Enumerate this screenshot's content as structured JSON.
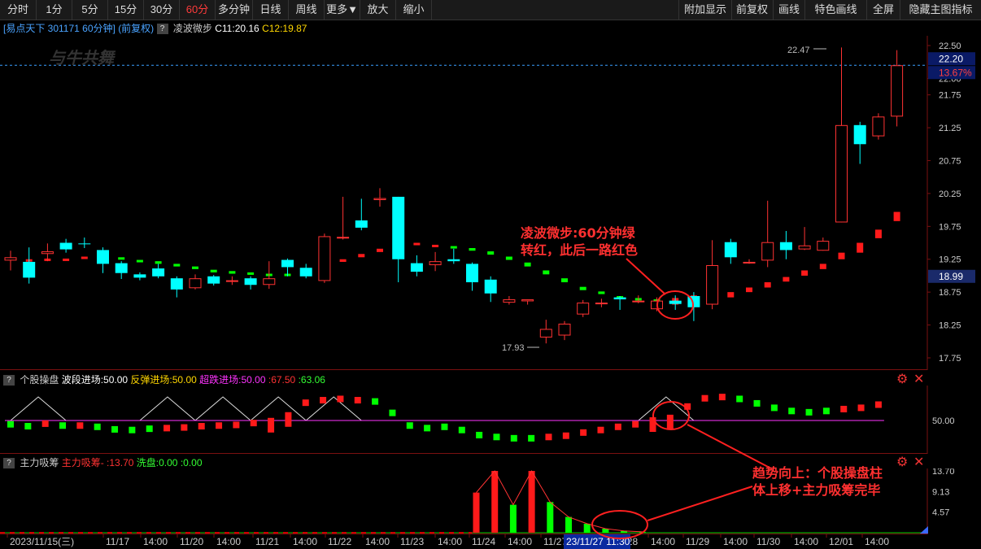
{
  "toolbar": {
    "left": [
      "分时",
      "1分",
      "5分",
      "15分",
      "30分",
      "60分",
      "多分钟",
      "日线",
      "周线",
      "更多▼",
      "放大",
      "缩小"
    ],
    "active": "60分",
    "right": [
      "附加显示",
      "前复权",
      "画线",
      "特色画线",
      "全屏",
      "隐藏主图指标"
    ]
  },
  "header": {
    "stock": "[易点天下 301171 60分钟]",
    "adjust": "(前复权)",
    "q": "?",
    "indicator_name": "凌波微步",
    "c1": "C11:20.16",
    "c2": "C12:19.87"
  },
  "watermark": "与牛共舞",
  "main": {
    "y_ticks": [
      "22.50",
      "22.00",
      "21.75",
      "21.25",
      "20.75",
      "20.25",
      "19.75",
      "19.25",
      "18.75",
      "18.25",
      "17.75"
    ],
    "price_badge": "22.20",
    "pct_badge": "13.67%",
    "cursor_badge": "18.99",
    "high_label": "22.47",
    "low_label": "17.93",
    "colors": {
      "up": "#ff3232",
      "down": "#00ffff",
      "bg": "#000000"
    },
    "candles": [
      [
        19.23,
        19.28,
        19.38,
        19.08
      ],
      [
        19.21,
        18.97,
        19.43,
        18.88
      ],
      [
        19.33,
        19.37,
        19.49,
        19.22
      ],
      [
        19.5,
        19.4,
        19.56,
        19.35
      ],
      [
        19.49,
        19.48,
        19.58,
        19.42
      ],
      [
        19.39,
        19.18,
        19.43,
        19.04
      ],
      [
        19.19,
        19.04,
        19.22,
        18.95
      ],
      [
        19.02,
        18.97,
        19.05,
        18.93
      ],
      [
        19.11,
        18.99,
        19.18,
        18.96
      ],
      [
        18.96,
        18.79,
        18.99,
        18.67
      ],
      [
        18.81,
        18.96,
        19.02,
        18.79
      ],
      [
        18.99,
        18.88,
        19.01,
        18.85
      ],
      [
        18.91,
        18.93,
        18.99,
        18.86
      ],
      [
        18.96,
        18.86,
        18.99,
        18.79
      ],
      [
        18.86,
        18.96,
        19.22,
        18.8
      ],
      [
        19.24,
        19.13,
        19.26,
        18.99
      ],
      [
        19.12,
        18.99,
        19.18,
        18.96
      ],
      [
        18.92,
        19.6,
        19.64,
        18.89
      ],
      [
        19.59,
        19.59,
        20.2,
        19.55
      ],
      [
        19.84,
        19.73,
        20.17,
        19.69
      ],
      [
        20.15,
        20.18,
        20.33,
        20.05
      ],
      [
        20.2,
        19.25,
        20.2,
        18.9
      ],
      [
        19.19,
        19.06,
        19.31,
        18.99
      ],
      [
        19.16,
        19.22,
        19.36,
        19.07
      ],
      [
        19.25,
        19.22,
        19.41,
        19.18
      ],
      [
        19.18,
        18.9,
        19.2,
        18.77
      ],
      [
        18.94,
        18.73,
        18.99,
        18.6
      ],
      [
        18.59,
        18.64,
        18.69,
        18.56
      ],
      [
        18.61,
        18.64,
        18.64,
        18.56
      ],
      [
        18.06,
        18.19,
        18.33,
        17.97
      ],
      [
        18.09,
        18.27,
        18.31,
        18.02
      ],
      [
        18.41,
        18.59,
        18.63,
        18.37
      ],
      [
        18.59,
        18.59,
        18.65,
        18.52
      ],
      [
        18.67,
        18.64,
        18.69,
        18.48
      ],
      [
        18.62,
        18.62,
        18.7,
        18.58
      ],
      [
        18.49,
        18.62,
        18.67,
        18.46
      ],
      [
        18.62,
        18.57,
        18.7,
        18.48
      ],
      [
        18.69,
        18.52,
        18.75,
        18.31
      ],
      [
        18.56,
        19.16,
        19.54,
        18.49
      ],
      [
        19.51,
        19.28,
        19.56,
        19.18
      ],
      [
        19.19,
        19.21,
        19.25,
        19.18
      ],
      [
        19.23,
        19.51,
        20.14,
        19.13
      ],
      [
        19.51,
        19.39,
        19.68,
        19.25
      ],
      [
        19.4,
        19.46,
        19.74,
        19.39
      ],
      [
        19.38,
        19.53,
        19.58,
        19.38
      ],
      [
        19.81,
        21.29,
        22.47,
        19.81
      ],
      [
        21.29,
        21.0,
        21.34,
        20.7
      ],
      [
        21.12,
        21.42,
        21.47,
        21.07
      ],
      [
        21.42,
        22.2,
        22.43,
        21.27
      ]
    ],
    "kai_bars": [
      [
        0,
        19.24,
        19.27,
        "r"
      ],
      [
        1,
        19.22,
        19.25,
        "r"
      ],
      [
        2,
        19.23,
        19.26,
        "r"
      ],
      [
        3,
        19.23,
        19.26,
        "r"
      ],
      [
        4,
        19.26,
        19.29,
        "r"
      ],
      [
        5,
        19.24,
        19.27,
        "r"
      ],
      [
        6,
        19.25,
        19.28,
        "g"
      ],
      [
        7,
        19.21,
        19.24,
        "g"
      ],
      [
        8,
        19.18,
        19.22,
        "g"
      ],
      [
        9,
        19.14,
        19.18,
        "g"
      ],
      [
        10,
        19.1,
        19.14,
        "g"
      ],
      [
        11,
        19.05,
        19.09,
        "g"
      ],
      [
        12,
        19.03,
        19.07,
        "g"
      ],
      [
        13,
        19.02,
        19.05,
        "g"
      ],
      [
        14,
        19.01,
        19.03,
        "g"
      ],
      [
        15,
        19.0,
        19.03,
        "g"
      ],
      [
        16,
        19.01,
        19.03,
        "g"
      ],
      [
        17,
        19.13,
        19.17,
        "r"
      ],
      [
        18,
        19.21,
        19.25,
        "r"
      ],
      [
        19,
        19.28,
        19.33,
        "r"
      ],
      [
        20,
        19.36,
        19.41,
        "r"
      ],
      [
        21,
        19.43,
        19.47,
        "r"
      ],
      [
        22,
        19.47,
        19.5,
        "r"
      ],
      [
        23,
        19.45,
        19.47,
        "r"
      ],
      [
        24,
        19.43,
        19.45,
        "g"
      ],
      [
        25,
        19.38,
        19.42,
        "g"
      ],
      [
        26,
        19.32,
        19.37,
        "g"
      ],
      [
        27,
        19.24,
        19.29,
        "g"
      ],
      [
        28,
        19.14,
        19.2,
        "g"
      ],
      [
        29,
        19.02,
        19.08,
        "g"
      ],
      [
        30,
        18.9,
        18.96,
        "g"
      ],
      [
        31,
        18.78,
        18.83,
        "g"
      ],
      [
        32,
        18.72,
        18.76,
        "g"
      ],
      [
        33,
        18.66,
        18.69,
        "g"
      ],
      [
        34,
        18.63,
        18.66,
        "g"
      ],
      [
        35,
        18.61,
        18.64,
        "g"
      ],
      [
        36,
        18.56,
        18.66,
        "r"
      ],
      [
        37,
        18.56,
        18.7,
        "r"
      ],
      [
        38,
        18.6,
        18.7,
        "r"
      ],
      [
        39,
        18.67,
        18.75,
        "r"
      ],
      [
        40,
        18.75,
        18.82,
        "r"
      ],
      [
        41,
        18.82,
        18.9,
        "r"
      ],
      [
        42,
        18.91,
        18.98,
        "r"
      ],
      [
        43,
        19.0,
        19.08,
        "r"
      ],
      [
        44,
        19.1,
        19.18,
        "r"
      ],
      [
        45,
        19.25,
        19.35,
        "r"
      ],
      [
        46,
        19.35,
        19.5,
        "r"
      ],
      [
        47,
        19.57,
        19.7,
        "r"
      ],
      [
        48,
        19.83,
        19.97,
        "r"
      ]
    ]
  },
  "sub1": {
    "q": "?",
    "name": "个股操盘",
    "l1": "波段进场:50.00",
    "l2": "反弹进场:50.00",
    "l3": "超跌进场:50.00",
    "v1": ":67.50",
    "v2": ":63.06",
    "tick": "50.00",
    "bars": [
      [
        44,
        "g"
      ],
      [
        41,
        "g"
      ],
      [
        45,
        "r"
      ],
      [
        42,
        "g"
      ],
      [
        42,
        "r"
      ],
      [
        40,
        "g"
      ],
      [
        36,
        "g"
      ],
      [
        35,
        "g"
      ],
      [
        37,
        "g"
      ],
      [
        38,
        "r"
      ],
      [
        39,
        "r"
      ],
      [
        41,
        "r"
      ],
      [
        42,
        "r"
      ],
      [
        43,
        "r"
      ],
      [
        46,
        "r"
      ],
      [
        49,
        "r"
      ],
      [
        58,
        "r"
      ],
      [
        78,
        "r"
      ],
      [
        82,
        "r"
      ],
      [
        84,
        "r"
      ],
      [
        82,
        "r"
      ],
      [
        80,
        "g"
      ],
      [
        62,
        "g"
      ],
      [
        42,
        "g"
      ],
      [
        38,
        "g"
      ],
      [
        40,
        "g"
      ],
      [
        35,
        "g"
      ],
      [
        27,
        "g"
      ],
      [
        24,
        "g"
      ],
      [
        22,
        "g"
      ],
      [
        22,
        "g"
      ],
      [
        24,
        "r"
      ],
      [
        26,
        "r"
      ],
      [
        31,
        "r"
      ],
      [
        35,
        "r"
      ],
      [
        40,
        "r"
      ],
      [
        44,
        "r"
      ],
      [
        50,
        "r"
      ],
      [
        54,
        "r"
      ],
      [
        72,
        "r"
      ],
      [
        85,
        "r"
      ],
      [
        87,
        "r"
      ],
      [
        84,
        "g"
      ],
      [
        77,
        "g"
      ],
      [
        70,
        "g"
      ],
      [
        65,
        "g"
      ],
      [
        63,
        "g"
      ],
      [
        65,
        "g"
      ],
      [
        68,
        "r"
      ],
      [
        70,
        "r"
      ],
      [
        75,
        "r"
      ]
    ],
    "triangles": [
      [
        0,
        3
      ],
      [
        7,
        10
      ],
      [
        10,
        13
      ],
      [
        13,
        16
      ],
      [
        16,
        19
      ],
      [
        34,
        37
      ]
    ]
  },
  "sub2": {
    "q": "?",
    "name": "主力吸筹",
    "l1": "主力吸筹-",
    "v1": ":13.70",
    "l2": "洗盘:0.00",
    "v2": ":0.00",
    "ticks": [
      "13.70",
      "9.13",
      "4.57"
    ],
    "bars": [
      [
        25,
        8.9,
        "r"
      ],
      [
        26,
        13.7,
        "r"
      ],
      [
        27,
        6.2,
        "g"
      ],
      [
        28,
        13.7,
        "r"
      ],
      [
        29,
        6.8,
        "g"
      ],
      [
        30,
        3.5,
        "g"
      ],
      [
        31,
        2.0,
        "g"
      ],
      [
        32,
        0.9,
        "g"
      ],
      [
        33,
        0.4,
        "g"
      ],
      [
        34,
        0.2,
        "g"
      ]
    ]
  },
  "xaxis": {
    "labels": [
      "2023/11/15(三)",
      "11/17",
      "14:00",
      "11/20",
      "14:00",
      "11/21",
      "14:00",
      "11/22",
      "14:00",
      "11/23",
      "14:00",
      "11/24",
      "14:00",
      "11/27",
      "14:00",
      "11/28",
      "14:00",
      "11/29",
      "14:00",
      "11/30",
      "14:00",
      "12/01",
      "14:00"
    ],
    "highlight": "23/11/27 11:30"
  },
  "annotations": {
    "a1_line1": "凌波微步:60分钟绿",
    "a1_line2": "转红，此后一路红色",
    "a2_line1": "趋势向上：个股操盘柱",
    "a2_line2": "体上移+主力吸筹完毕"
  },
  "sub_controls": {
    "gear": "⚙",
    "close": "✕"
  }
}
